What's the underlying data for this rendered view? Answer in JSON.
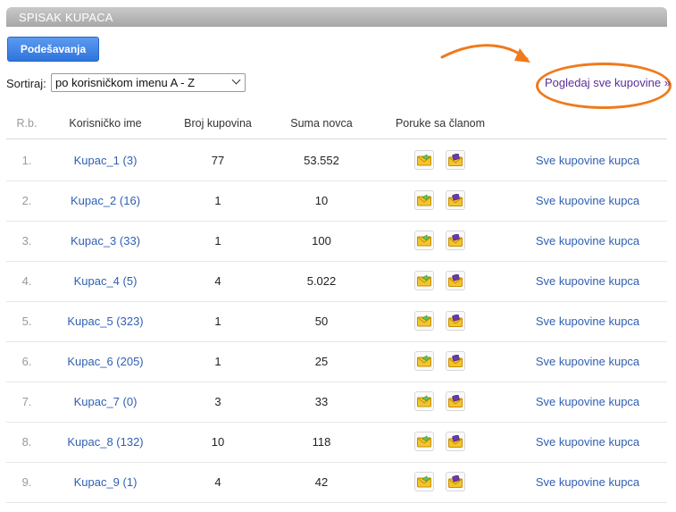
{
  "title": "SPISAK KUPACA",
  "settings_label": "Podešavanja",
  "sort": {
    "label": "Sortiraj:",
    "value": "po korisničkom imenu A - Z"
  },
  "view_all_link": "Pogledaj sve kupovine »",
  "headers": {
    "rb": "R.b.",
    "name": "Korisničko ime",
    "broj": "Broj kupovina",
    "suma": "Suma novca",
    "poruke": "Poruke sa članom"
  },
  "colors": {
    "link": "#2f5fb3",
    "accent_purple": "#5a2f9a",
    "annotation": "#f07a1c",
    "button": "#3a80e4"
  },
  "icons": {
    "send_message": "envelope-green-arrow-icon",
    "received_message": "envelope-purple-icon"
  },
  "rows": [
    {
      "rb": "1.",
      "name": "Kupac_1 (3)",
      "broj": "77",
      "suma": "53.552",
      "all": "Sve kupovine kupca"
    },
    {
      "rb": "2.",
      "name": "Kupac_2 (16)",
      "broj": "1",
      "suma": "10",
      "all": "Sve kupovine kupca"
    },
    {
      "rb": "3.",
      "name": "Kupac_3 (33)",
      "broj": "1",
      "suma": "100",
      "all": "Sve kupovine kupca"
    },
    {
      "rb": "4.",
      "name": "Kupac_4 (5)",
      "broj": "4",
      "suma": "5.022",
      "all": "Sve kupovine kupca"
    },
    {
      "rb": "5.",
      "name": "Kupac_5 (323)",
      "broj": "1",
      "suma": "50",
      "all": "Sve kupovine kupca"
    },
    {
      "rb": "6.",
      "name": "Kupac_6 (205)",
      "broj": "1",
      "suma": "25",
      "all": "Sve kupovine kupca"
    },
    {
      "rb": "7.",
      "name": "Kupac_7 (0)",
      "broj": "3",
      "suma": "33",
      "all": "Sve kupovine kupca"
    },
    {
      "rb": "8.",
      "name": "Kupac_8 (132)",
      "broj": "10",
      "suma": "118",
      "all": "Sve kupovine kupca"
    },
    {
      "rb": "9.",
      "name": "Kupac_9 (1)",
      "broj": "4",
      "suma": "42",
      "all": "Sve kupovine kupca"
    }
  ]
}
